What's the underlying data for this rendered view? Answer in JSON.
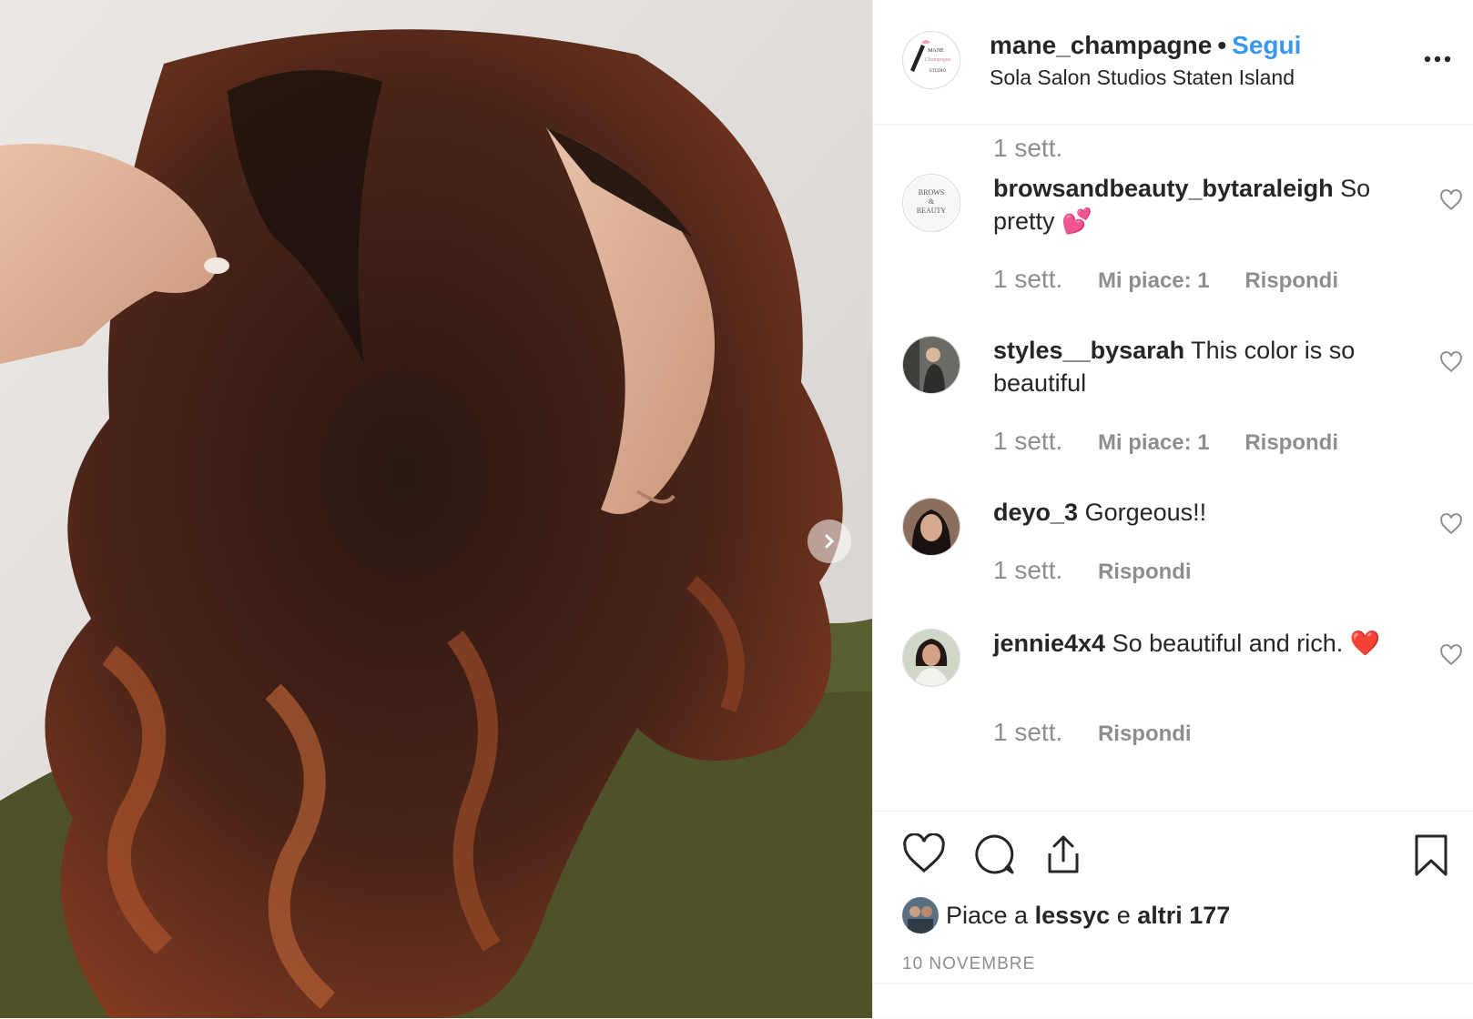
{
  "post": {
    "username": "mane_champagne",
    "separator": "•",
    "follow_label": "Segui",
    "location": "Sola Salon Studios Staten Island",
    "top_time": "1 sett.",
    "avatar_text": [
      "MANE",
      "Champagne",
      "STUDIO"
    ]
  },
  "comments": [
    {
      "user": "browsandbeauty_bytaraleigh",
      "text": "So pretty 💕",
      "time": "1 sett.",
      "likes": "Mi piace: 1",
      "reply": "Rispondi",
      "avatar_text": [
        "BROWS",
        "&",
        "BEAUTY"
      ]
    },
    {
      "user": "styles__bysarah",
      "text": "This color is so beautiful",
      "time": "1 sett.",
      "likes": "Mi piace: 1",
      "reply": "Rispondi"
    },
    {
      "user": "deyo_3",
      "text": "Gorgeous!!",
      "time": "1 sett.",
      "reply": "Rispondi"
    },
    {
      "user": "jennie4x4",
      "text": "So beautiful and rich. ❤️",
      "time": "1 sett.",
      "reply": "Rispondi"
    }
  ],
  "footer": {
    "likes_prefix": "Piace a",
    "likes_user": "lessyc",
    "likes_and": "e",
    "likes_others": "altri 177",
    "date": "10 NOVEMBRE"
  },
  "icons": [
    "chevron-right-icon",
    "more-icon",
    "heart-icon",
    "comment-icon",
    "share-icon",
    "bookmark-icon"
  ],
  "colors": {
    "link": "#3897f0",
    "text": "#262626",
    "muted": "#8e8e8e",
    "border": "#efefef"
  }
}
